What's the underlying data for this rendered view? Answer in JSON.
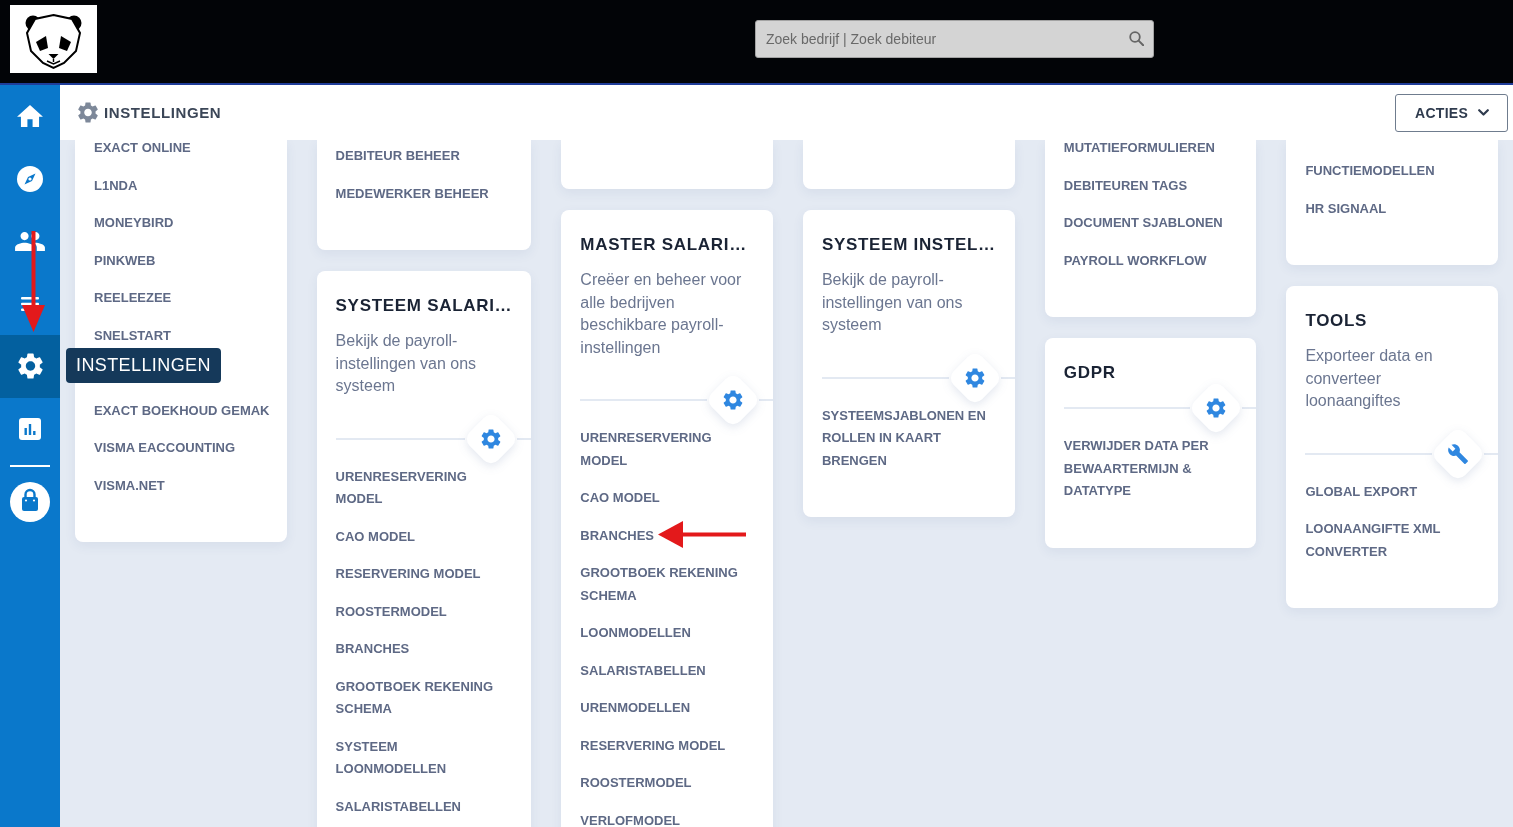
{
  "topbar": {
    "search": {
      "placeholder": "Zoek bedrijf | Zoek debiteur"
    }
  },
  "sidebar": {
    "items": [
      {
        "kind": "home",
        "selected": false
      },
      {
        "kind": "compass",
        "selected": false
      },
      {
        "kind": "users",
        "selected": false
      },
      {
        "kind": "list",
        "selected": false
      },
      {
        "kind": "settings",
        "selected": true
      },
      {
        "kind": "chart",
        "selected": false
      }
    ],
    "bottom_items": [
      {
        "kind": "bag",
        "selected": false
      }
    ],
    "tooltip": "INSTELLINGEN"
  },
  "header": {
    "title": "INSTELLINGEN",
    "actions_button": "ACTIES"
  },
  "columns": [
    {
      "cards": [
        {
          "kind": "continued",
          "links": [
            "EXACT ONLINE",
            "L1NDA",
            "MONEYBIRD",
            "PINKWEB",
            "REELEEZEE",
            "SNELSTART",
            "EXACT BOEKHOUD GEMAK",
            "VISMA EACCOUNTING",
            "VISMA.NET"
          ]
        }
      ]
    },
    {
      "cards": [
        {
          "kind": "continued",
          "links": [
            "DEBITEUR BEHEER",
            "MEDEWERKER BEHEER"
          ]
        },
        {
          "kind": "section",
          "title": "SYSTEEM SALARI…",
          "description": "Bekijk de payroll-instellingen van ons systeem",
          "badge": {
            "kind": "gear"
          },
          "links": [
            "URENRESERVERING MODEL",
            "CAO MODEL",
            "RESERVERING MODEL",
            "ROOSTERMODEL",
            "BRANCHES",
            "GROOTBOEK REKENING SCHEMA",
            "SYSTEEM LOONMODELLEN",
            "SALARISTABELLEN"
          ]
        }
      ]
    },
    {
      "cards": [
        {
          "kind": "continued"
        },
        {
          "kind": "section",
          "title": "MASTER SALARI…",
          "description": "Creëer en beheer voor alle bedrijven beschikbare payroll-instellingen",
          "badge": {
            "kind": "gear"
          },
          "links": [
            "URENRESERVERING MODEL",
            "CAO MODEL",
            "BRANCHES",
            "GROOTBOEK REKENING SCHEMA",
            "LOONMODELLEN",
            "SALARISTABELLEN",
            "URENMODELLEN",
            "RESERVERING MODEL",
            "ROOSTERMODEL",
            "VERLOFMODEL"
          ]
        }
      ]
    },
    {
      "cards": [
        {
          "kind": "continued"
        },
        {
          "kind": "section",
          "title": "SYSTEEM INSTEL…",
          "description": "Bekijk de payroll-instellingen van ons systeem",
          "badge": {
            "kind": "gear"
          },
          "links": [
            "SYSTEEMSJABLONEN EN ROLLEN IN KAART BRENGEN"
          ]
        }
      ]
    },
    {
      "cards": [
        {
          "kind": "continued",
          "links": [
            "MUTATIEFORMULIEREN",
            "DEBITEUREN TAGS",
            "DOCUMENT SJABLONEN",
            "PAYROLL WORKFLOW"
          ]
        },
        {
          "kind": "section",
          "title": "GDPR",
          "badge": {
            "kind": "gear"
          },
          "links": [
            "VERWIJDER DATA PER BEWAARTERMIJN & DATATYPE"
          ]
        }
      ]
    },
    {
      "cards": [
        {
          "kind": "continued",
          "links": [
            "FUNCTIEMODELLEN",
            "HR SIGNAAL"
          ]
        },
        {
          "kind": "section",
          "title": "TOOLS",
          "description": "Exporteer data en converteer loonaangiftes",
          "badge": {
            "kind": "wrench"
          },
          "links": [
            "GLOBAL EXPORT",
            "LOONAANGIFTE XML CONVERTER"
          ]
        }
      ]
    }
  ]
}
